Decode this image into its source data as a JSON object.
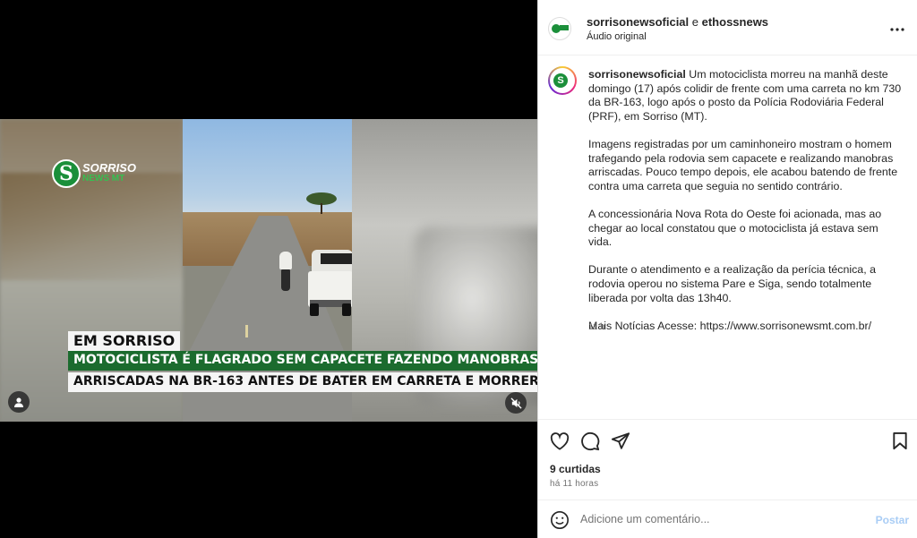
{
  "video": {
    "logo_line1": "SORRISO",
    "logo_line2": "NEWS MT",
    "caption1": "EM SORRISO",
    "caption2": "MOTOCICLISTA É FLAGRADO SEM CAPACETE FAZENDO MANOBRAS",
    "caption3": "ARRISCADAS NA BR-163 ANTES DE BATER EM CARRETA E MORRER",
    "muted": true
  },
  "header": {
    "author": "sorrisonewsoficial",
    "conjunction": " e ",
    "collaborator": "ethossnews",
    "audio": "Áudio original"
  },
  "post": {
    "username": "sorrisonewsoficial",
    "p1": "Um motociclista morreu na manhã deste domingo (17) após colidir de frente com uma carreta no km 730 da BR-163, logo após o posto da Polícia Rodoviária Federal (PRF), em Sorriso (MT).",
    "p2": "Imagens registradas por um caminhoneiro mostram o homem trafegando pela rodovia sem capacete e realizando manobras arriscadas. Pouco tempo depois, ele acabou batendo de frente contra uma carreta que seguia no sentido contrário.",
    "p3": "A concessionária Nova Rota do Oeste foi acionada, mas ao chegar ao local constatou que o motociclista já estava sem vida.",
    "p4": "Durante o atendimento e a realização da perícia técnica, a rodovia operou no sistema Pare e Siga, sendo totalmente liberada por volta das 13h40.",
    "p5": "Mais Notícias Acesse: https://www.sorrisonewsmt.com.br/",
    "time": "11 h"
  },
  "engagement": {
    "likes": "9 curtidas",
    "posted": "há 11 horas"
  },
  "comment": {
    "placeholder": "Adicione um comentário...",
    "post_label": "Postar"
  },
  "colors": {
    "brand_green": "#1b8f3a",
    "post_button": "#a9cdf5"
  },
  "icons": [
    "user-icon",
    "mute-icon",
    "more-icon",
    "heart-icon",
    "comment-icon",
    "share-icon",
    "bookmark-icon",
    "emoji-icon"
  ]
}
